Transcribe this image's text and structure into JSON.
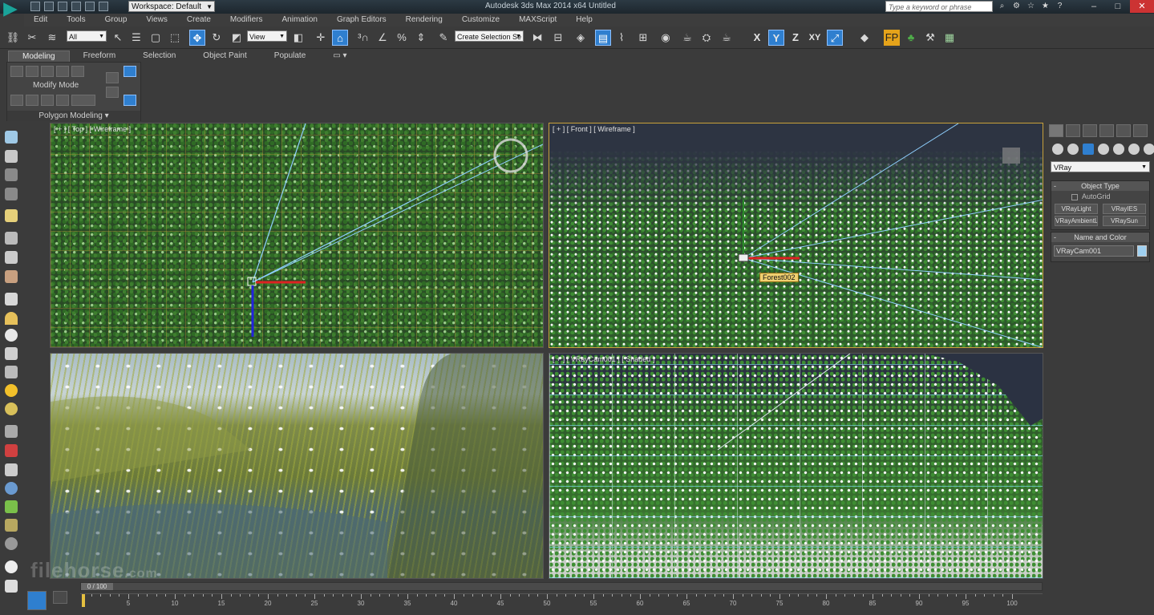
{
  "titlebar": {
    "workspace": "Workspace: Default",
    "app_title": "Autodesk 3ds Max 2014 x64     Untitled",
    "search_placeholder": "Type a keyword or phrase"
  },
  "menu": [
    "Edit",
    "Tools",
    "Group",
    "Views",
    "Create",
    "Modifiers",
    "Animation",
    "Graph Editors",
    "Rendering",
    "Customize",
    "MAXScript",
    "Help"
  ],
  "toolbar": {
    "filter_select": "All",
    "ref_coord_select": "View",
    "selection_set": "Create Selection Se",
    "axis_labels": [
      "X",
      "Y",
      "Z",
      "XY"
    ]
  },
  "ribbon": {
    "tabs": [
      "Modeling",
      "Freeform",
      "Selection",
      "Object Paint",
      "Populate"
    ],
    "active_tab": "Modeling",
    "modify_mode": "Modify Mode",
    "polygon_modeling": "Polygon Modeling"
  },
  "viewports": {
    "top": "[ + ] [ Top ] [ Wireframe ]",
    "front": "[ + ] [ Front ] [ Wireframe ]",
    "camera": "[ + ] [ VRayCam001 ] [ Shaded ]",
    "object_tag": "Forest002"
  },
  "command_panel": {
    "renderer": "VRay",
    "object_type_title": "Object Type",
    "autogrid": "AutoGrid",
    "buttons": [
      "VRayLight",
      "VRayIES",
      "VRayAmbientLig",
      "VRaySun"
    ],
    "name_color_title": "Name and Color",
    "object_name": "VRayCam001",
    "swatch_color": "#9fd0f0"
  },
  "timeline": {
    "frame_display": "0 / 100",
    "current_frame": 0,
    "total_frames": 100,
    "ticks": [
      5,
      10,
      15,
      20,
      25,
      30,
      35,
      40,
      45,
      50,
      55,
      60,
      65,
      70,
      75,
      80,
      85,
      90,
      95,
      100
    ]
  },
  "watermark": "filehorse",
  "watermark_suffix": ".com"
}
